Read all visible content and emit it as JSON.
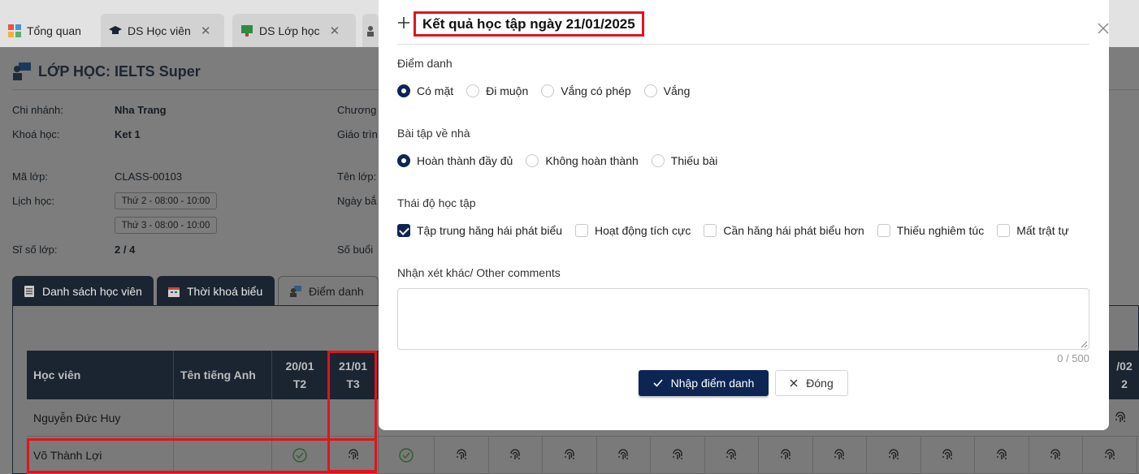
{
  "tabs": [
    {
      "label": "Tổng quan"
    },
    {
      "label": "DS Học viên",
      "close": "✕"
    },
    {
      "label": "DS Lớp học",
      "close": "✕"
    }
  ],
  "class_page": {
    "title": "LỚP HỌC: IELTS Super",
    "fields": {
      "branch_label": "Chi nhánh:",
      "branch_value": "Nha Trang",
      "course_label": "Khoá học:",
      "course_value": "Ket 1",
      "code_label": "Mã lớp:",
      "code_value": "CLASS-00103",
      "schedule_label": "Lịch học:",
      "schedule_slots": [
        "Thứ 2 - 08:00 - 10:00",
        "Thứ 3 - 08:00 - 10:00"
      ],
      "size_label": "Sĩ số lớp:",
      "size_value": "2 / 4",
      "program_label": "Chương",
      "syllabus_label": "Giáo trìn",
      "classname_label": "Tên lớp:",
      "startdate_label": "Ngày bắ",
      "sessions_label": "Số buổi"
    },
    "detail_tabs": [
      {
        "label": "Danh sách học viên"
      },
      {
        "label": "Thời khoá biểu"
      },
      {
        "label": "Điểm danh"
      }
    ],
    "grid": {
      "col_student": "Học viên",
      "col_english_name": "Tên tiếng Anh",
      "dates": [
        {
          "date": "20/01",
          "day": "T2"
        },
        {
          "date": "21/01",
          "day": "T3"
        }
      ],
      "right_partial_date": "/02",
      "right_partial_day": "2",
      "rows": [
        {
          "name": "Nguyễn Đức Huy"
        },
        {
          "name": "Võ Thành Lợi"
        }
      ]
    }
  },
  "modal": {
    "title": "Kết quả học tập ngày 21/01/2025",
    "attendance": {
      "label": "Điểm danh",
      "options": [
        "Có mặt",
        "Đi muộn",
        "Vắng có phép",
        "Vắng"
      ],
      "selected": "Có mặt"
    },
    "homework": {
      "label": "Bài tập về nhà",
      "options": [
        "Hoàn thành đầy đủ",
        "Không hoàn thành",
        "Thiếu bài"
      ],
      "selected": "Hoàn thành đầy đủ"
    },
    "attitude": {
      "label": "Thái độ học tập",
      "options": [
        "Tập trung hăng hái phát biểu",
        "Hoạt động tích cực",
        "Cần hăng hái phát biểu hơn",
        "Thiếu nghiêm túc",
        "Mất trật tự"
      ],
      "checked": [
        "Tập trung hăng hái phát biểu"
      ]
    },
    "comments": {
      "label": "Nhận xét khác/ Other comments",
      "value": "",
      "counter": "0 / 500"
    },
    "submit_label": "Nhập điểm danh",
    "close_label": "Đóng"
  },
  "colors": {
    "primary": "#0d2552",
    "header_dark": "#1b2431",
    "highlight": "#e0141c",
    "check_green": "#2e7d32"
  }
}
